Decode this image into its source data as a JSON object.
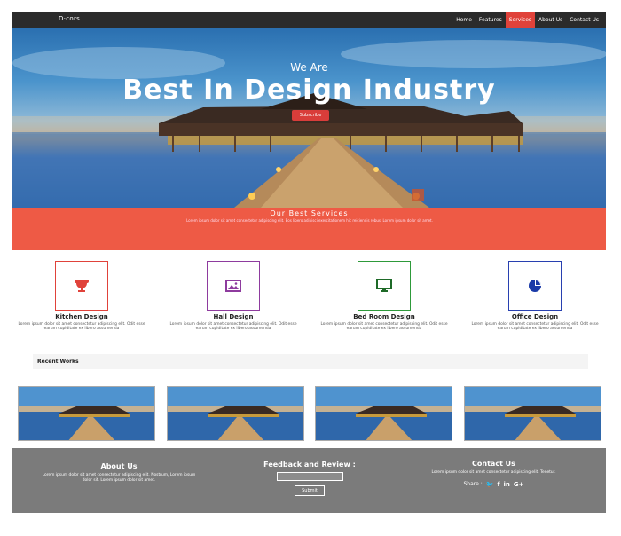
{
  "nav": {
    "brand": "D·cors",
    "links": [
      "Home",
      "Features",
      "Services",
      "About Us",
      "Contact Us"
    ],
    "active_index": 2
  },
  "hero": {
    "subtitle": "We Are",
    "title": "Best In Design Industry",
    "button": "Subscribe"
  },
  "services_banner": {
    "title": "Our Best Services",
    "desc": "Lorem ipsum dolor sit amet consectetur adipiscing elit. Eos libero adipisci exercitationem hic reiciendis rebus. Lorem ipsum dolor sit amet."
  },
  "services": [
    {
      "name": "Kitchen Design",
      "desc": "Lorem ipsum dolor sit amet consectetur adipiscing elit. Odit esse earum cupiditate ex libero assumenda",
      "color": "#e0423a",
      "icon": "trophy-icon"
    },
    {
      "name": "Hall Design",
      "desc": "Lorem ipsum dolor sit amet consectetur adipiscing elit. Odit esse earum cupiditate ex libero assumenda",
      "color": "#8e3b9e",
      "icon": "image-icon"
    },
    {
      "name": "Bed Room Design",
      "desc": "Lorem ipsum dolor sit amet consectetur adipiscing elit. Odit esse earum cupiditate ex libero assumenda",
      "color": "#2e9a3a",
      "icon": "monitor-icon"
    },
    {
      "name": "Office Design",
      "desc": "Lorem ipsum dolor sit amet consectetur adipiscing elit. Odit esse earum cupiditate ex libero assumenda",
      "color": "#2840b0",
      "icon": "pie-chart-icon"
    }
  ],
  "recent_works": {
    "label": "Recent Works"
  },
  "footer": {
    "about_title": "About Us",
    "about_text": "Lorem ipsum dolor sit amet consectetur adipiscing elit. Nostrum, Lorem ipsum dolor sit. Lorem ipsum dolor sit amet.",
    "feedback_title": "Feedback and Review :",
    "submit": "Submit",
    "contact_title": "Contact Us",
    "contact_text": "Lorem ipsum dolor sit amet consectetur adipiscing elit. Tenetur.",
    "share_label": "Share :",
    "social": [
      "twitter-icon",
      "facebook-icon",
      "linkedin-icon",
      "google-plus-icon"
    ],
    "social_glyphs": [
      "🐦",
      "f",
      "in",
      "G+"
    ]
  }
}
